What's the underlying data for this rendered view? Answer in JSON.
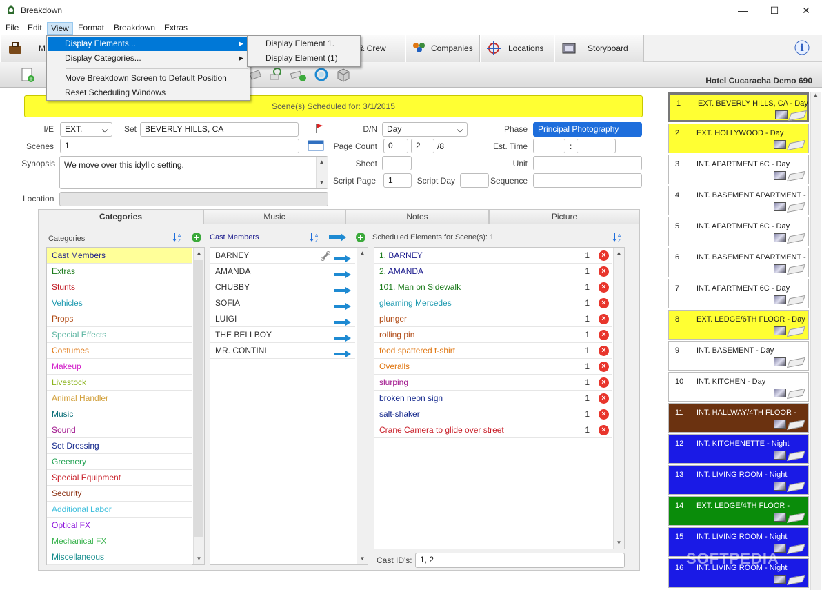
{
  "window": {
    "title": "Breakdown",
    "minimize": "—",
    "maximize": "☐",
    "close": "✕"
  },
  "menubar": [
    "File",
    "Edit",
    "View",
    "Format",
    "Breakdown",
    "Extras"
  ],
  "tabs": {
    "first": "Ma",
    "cast_crew": "rs & Crew",
    "companies": "Companies",
    "locations": "Locations",
    "storyboard": "Storyboard"
  },
  "project_title": "Hotel Cucaracha Demo 690",
  "view_menu": {
    "items": [
      "Display Elements...",
      "Display Categories...",
      "Move Breakdown Screen to Default Position",
      "Reset Scheduling Windows"
    ],
    "submenu": [
      "Display Element 1.",
      "Display Element (1)"
    ]
  },
  "scheduled_banner": "Scene(s) Scheduled for: 3/1/2015",
  "form": {
    "ie_label": "I/E",
    "ie_value": "EXT.",
    "set_label": "Set",
    "set_value": "BEVERLY HILLS, CA",
    "dn_label": "D/N",
    "dn_value": "Day",
    "phase_label": "Phase",
    "phase_value": "Principal Photography",
    "scenes_label": "Scenes",
    "scenes_value": "1",
    "page_count_label": "Page Count",
    "page_count_whole": "0",
    "page_count_eighths": "2",
    "page_count_suffix": "/8",
    "est_time_label": "Est. Time",
    "est_time_sep": ":",
    "synopsis_label": "Synopsis",
    "synopsis_value": "We move over this idyllic setting.",
    "sheet_label": "Sheet",
    "unit_label": "Unit",
    "script_page_label": "Script Page",
    "script_page_value": "1",
    "script_day_label": "Script Day",
    "sequence_label": "Sequence",
    "location_label": "Location"
  },
  "subtabs": [
    "Categories",
    "Music",
    "Notes",
    "Picture"
  ],
  "categories_header": "Categories",
  "categories": [
    {
      "label": "Cast Members",
      "color": "#1a1a8c"
    },
    {
      "label": "Extras",
      "color": "#1a7a1a"
    },
    {
      "label": "Stunts",
      "color": "#c0141e"
    },
    {
      "label": "Vehicles",
      "color": "#1e9ab0"
    },
    {
      "label": "Props",
      "color": "#b04a14"
    },
    {
      "label": "Special Effects",
      "color": "#5ab4a0"
    },
    {
      "label": "Costumes",
      "color": "#e07814"
    },
    {
      "label": "Makeup",
      "color": "#d21ec8"
    },
    {
      "label": "Livestock",
      "color": "#8cb41e"
    },
    {
      "label": "Animal Handler",
      "color": "#d2a03c"
    },
    {
      "label": "Music",
      "color": "#0a6e78"
    },
    {
      "label": "Sound",
      "color": "#a0148c"
    },
    {
      "label": "Set Dressing",
      "color": "#14288c"
    },
    {
      "label": "Greenery",
      "color": "#1ea050"
    },
    {
      "label": "Special Equipment",
      "color": "#c81e28"
    },
    {
      "label": "Security",
      "color": "#8c3214"
    },
    {
      "label": "Additional Labor",
      "color": "#3cbedc"
    },
    {
      "label": "Optical FX",
      "color": "#8c14dc"
    },
    {
      "label": "Mechanical FX",
      "color": "#3cb450"
    },
    {
      "label": "Miscellaneous",
      "color": "#148c8c"
    }
  ],
  "cast_header": "Cast Members",
  "cast_members": [
    "BARNEY",
    "AMANDA",
    "CHUBBY",
    "SOFIA",
    "LUIGI",
    "THE BELLBOY",
    "MR. CONTINI"
  ],
  "scheduled_header": "Scheduled Elements for Scene(s): 1",
  "scheduled_elements": [
    {
      "prefix": "1. ",
      "label": "BARNEY",
      "count": "1",
      "color": "#1a1a8c"
    },
    {
      "prefix": "2. ",
      "label": "AMANDA",
      "count": "1",
      "color": "#1a1a8c"
    },
    {
      "prefix": "101. ",
      "label": "Man on Sidewalk",
      "count": "1",
      "color": "#1a7a1a"
    },
    {
      "prefix": "",
      "label": "gleaming Mercedes",
      "count": "1",
      "color": "#1e9ab0"
    },
    {
      "prefix": "",
      "label": "plunger",
      "count": "1",
      "color": "#b04a14"
    },
    {
      "prefix": "",
      "label": "rolling pin",
      "count": "1",
      "color": "#b04a14"
    },
    {
      "prefix": "",
      "label": "food spattered t-shirt",
      "count": "1",
      "color": "#e07814"
    },
    {
      "prefix": "",
      "label": "Overalls",
      "count": "1",
      "color": "#e07814"
    },
    {
      "prefix": "",
      "label": "slurping",
      "count": "1",
      "color": "#a0148c"
    },
    {
      "prefix": "",
      "label": "broken neon sign",
      "count": "1",
      "color": "#14288c"
    },
    {
      "prefix": "",
      "label": "salt-shaker",
      "count": "1",
      "color": "#14288c"
    },
    {
      "prefix": "",
      "label": "Crane Camera to glide over street",
      "count": "1",
      "color": "#c81e28"
    }
  ],
  "cast_ids_label": "Cast ID's:",
  "cast_ids_value": "1, 2",
  "strips": [
    {
      "num": "1",
      "desc": "EXT. BEVERLY HILLS, CA  - Day",
      "bg": "#ffff33",
      "fg": "#222222"
    },
    {
      "num": "2",
      "desc": "EXT. HOLLYWOOD  - Day",
      "bg": "#ffff33",
      "fg": "#222222"
    },
    {
      "num": "3",
      "desc": "INT. APARTMENT 6C  - Day",
      "bg": "#ffffff",
      "fg": "#222222"
    },
    {
      "num": "4",
      "desc": "INT. BASEMENT APARTMENT  -",
      "bg": "#ffffff",
      "fg": "#222222"
    },
    {
      "num": "5",
      "desc": "INT. APARTMENT 6C  - Day",
      "bg": "#ffffff",
      "fg": "#222222"
    },
    {
      "num": "6",
      "desc": "INT. BASEMENT APARTMENT  -",
      "bg": "#ffffff",
      "fg": "#222222"
    },
    {
      "num": "7",
      "desc": "INT. APARTMENT 6C  - Day",
      "bg": "#ffffff",
      "fg": "#222222"
    },
    {
      "num": "8",
      "desc": "EXT. LEDGE/6TH FLOOR  - Day",
      "bg": "#ffff33",
      "fg": "#222222"
    },
    {
      "num": "9",
      "desc": "INT. BASEMENT  - Day",
      "bg": "#ffffff",
      "fg": "#222222"
    },
    {
      "num": "10",
      "desc": "INT. KITCHEN  - Day",
      "bg": "#ffffff",
      "fg": "#222222"
    },
    {
      "num": "11",
      "desc": "INT. HALLWAY/4TH FLOOR  -",
      "bg": "#6b3210",
      "fg": "#ffffff"
    },
    {
      "num": "12",
      "desc": "INT. KITCHENETTE  - Night",
      "bg": "#1a1ae6",
      "fg": "#ffffff"
    },
    {
      "num": "13",
      "desc": "INT. LIVING ROOM  - Night",
      "bg": "#1a1ae6",
      "fg": "#ffffff"
    },
    {
      "num": "14",
      "desc": "EXT. LEDGE/4TH FLOOR  -",
      "bg": "#0a8c0a",
      "fg": "#ffffff"
    },
    {
      "num": "15",
      "desc": "INT. LIVING ROOM  - Night",
      "bg": "#1a1ae6",
      "fg": "#ffffff"
    },
    {
      "num": "16",
      "desc": "INT. LIVING ROOM  - Night",
      "bg": "#1a1ae6",
      "fg": "#ffffff"
    }
  ],
  "watermark": "SOFTPEDIA"
}
